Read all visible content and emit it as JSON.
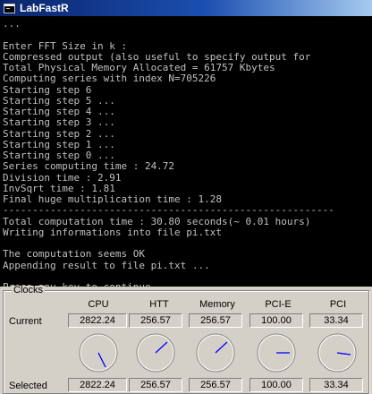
{
  "window": {
    "title": "LabFastR",
    "icon": "console-icon"
  },
  "console": {
    "lines": [
      "...",
      "",
      "Enter FFT Size in k :",
      "Compressed output (also useful to specify output for",
      "Total Physical Memory Allocated = 61757 Kbytes",
      "Computing series with index N=705226",
      "Starting step 6",
      "Starting step 5 ...",
      "Starting step 4 ...",
      "Starting step 3 ...",
      "Starting step 2 ...",
      "Starting step 1 ...",
      "Starting step 0 ...",
      "Series computing time : 24.72",
      "Division time : 2.91",
      "InvSqrt time : 1.81",
      "Final huge multiplication time : 1.28",
      "--------------------------------------------------------",
      "Total computation time : 30.80 seconds(~ 0.01 hours)",
      "Writing informations into file pi.txt",
      "",
      "The computation seems OK",
      "Appending result to file pi.txt ...",
      "",
      "Press any key to continue . . ."
    ],
    "text_color": "#c0c0c0",
    "background_color": "#000000"
  },
  "clocks": {
    "group_label": "Clocks",
    "columns": [
      "CPU",
      "HTT",
      "Memory",
      "PCI-E",
      "PCI"
    ],
    "current_label": "Current",
    "selected_label": "Selected",
    "current_values": [
      "2822.24",
      "256.57",
      "256.57",
      "100.00",
      "33.34"
    ],
    "selected_values": [
      "2822.24",
      "256.57",
      "256.57",
      "100.00",
      "33.34"
    ],
    "dial_hand_color": "#0000ff"
  }
}
